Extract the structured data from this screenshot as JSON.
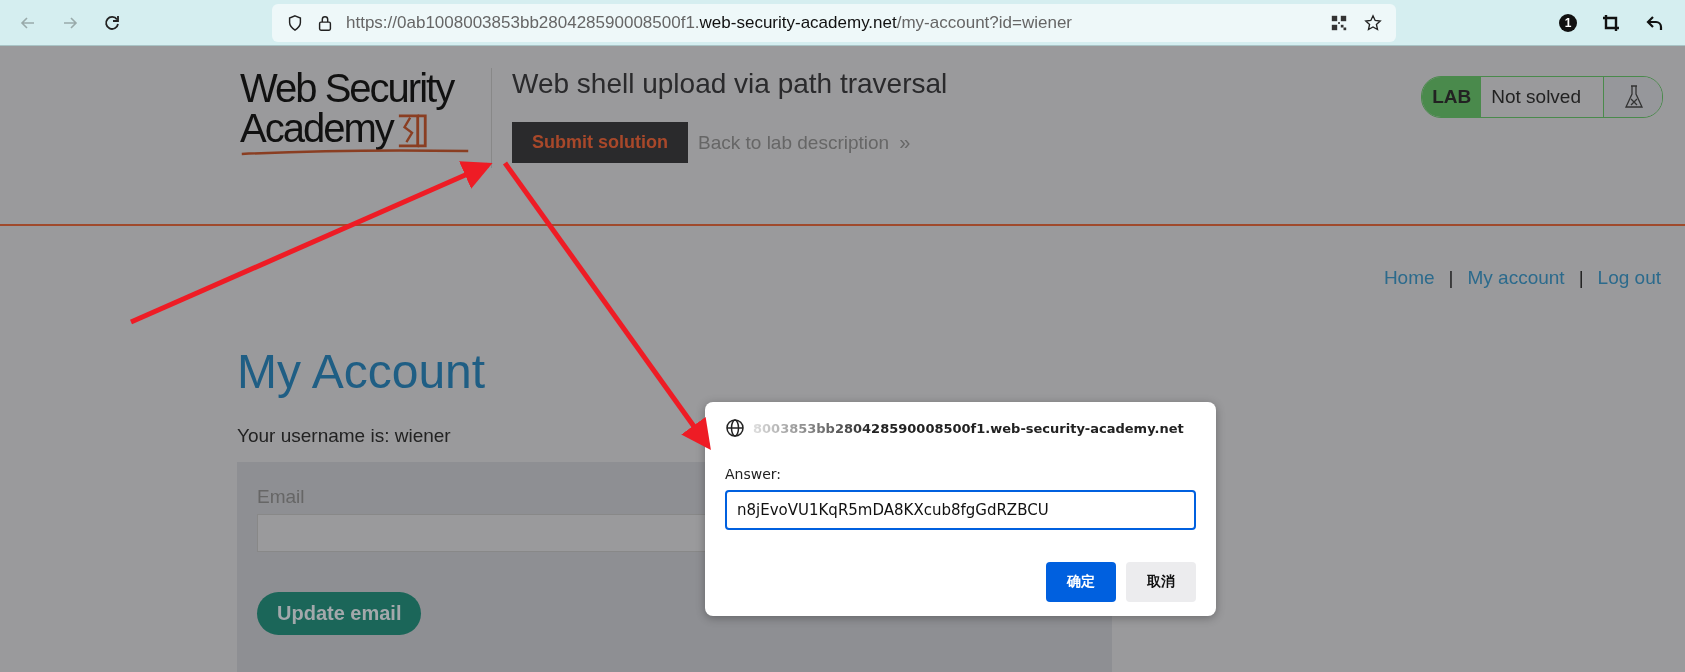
{
  "browser": {
    "url": {
      "prefix": "https://0ab1008003853bb280428590008500f1.",
      "domain": "web-security-academy.net",
      "path": "/my-account?id=wiener"
    },
    "extension_badge": "1"
  },
  "header": {
    "logo": {
      "line_1": "Web Security",
      "line_2": "Academy"
    },
    "title": "Web shell upload via path traversal",
    "submit_button": "Submit solution",
    "back_link": "Back to lab description",
    "back_link_icon": "»",
    "lab_badge": {
      "label": "LAB",
      "status": "Not solved"
    }
  },
  "nav": {
    "links": [
      "Home",
      "My account",
      "Log out"
    ],
    "separator": "|"
  },
  "page": {
    "heading": "My Account",
    "username_line": "Your username is: wiener",
    "email_label": "Email",
    "update_button": "Update email"
  },
  "dialog": {
    "host": "8003853bb280428590008500f1.web-security-academy.net",
    "label": "Answer:",
    "value": "n8jEvoVU1KqR5mDA8KXcub8fgGdRZBCU",
    "ok_button": "确定",
    "cancel_button": "取消"
  }
}
